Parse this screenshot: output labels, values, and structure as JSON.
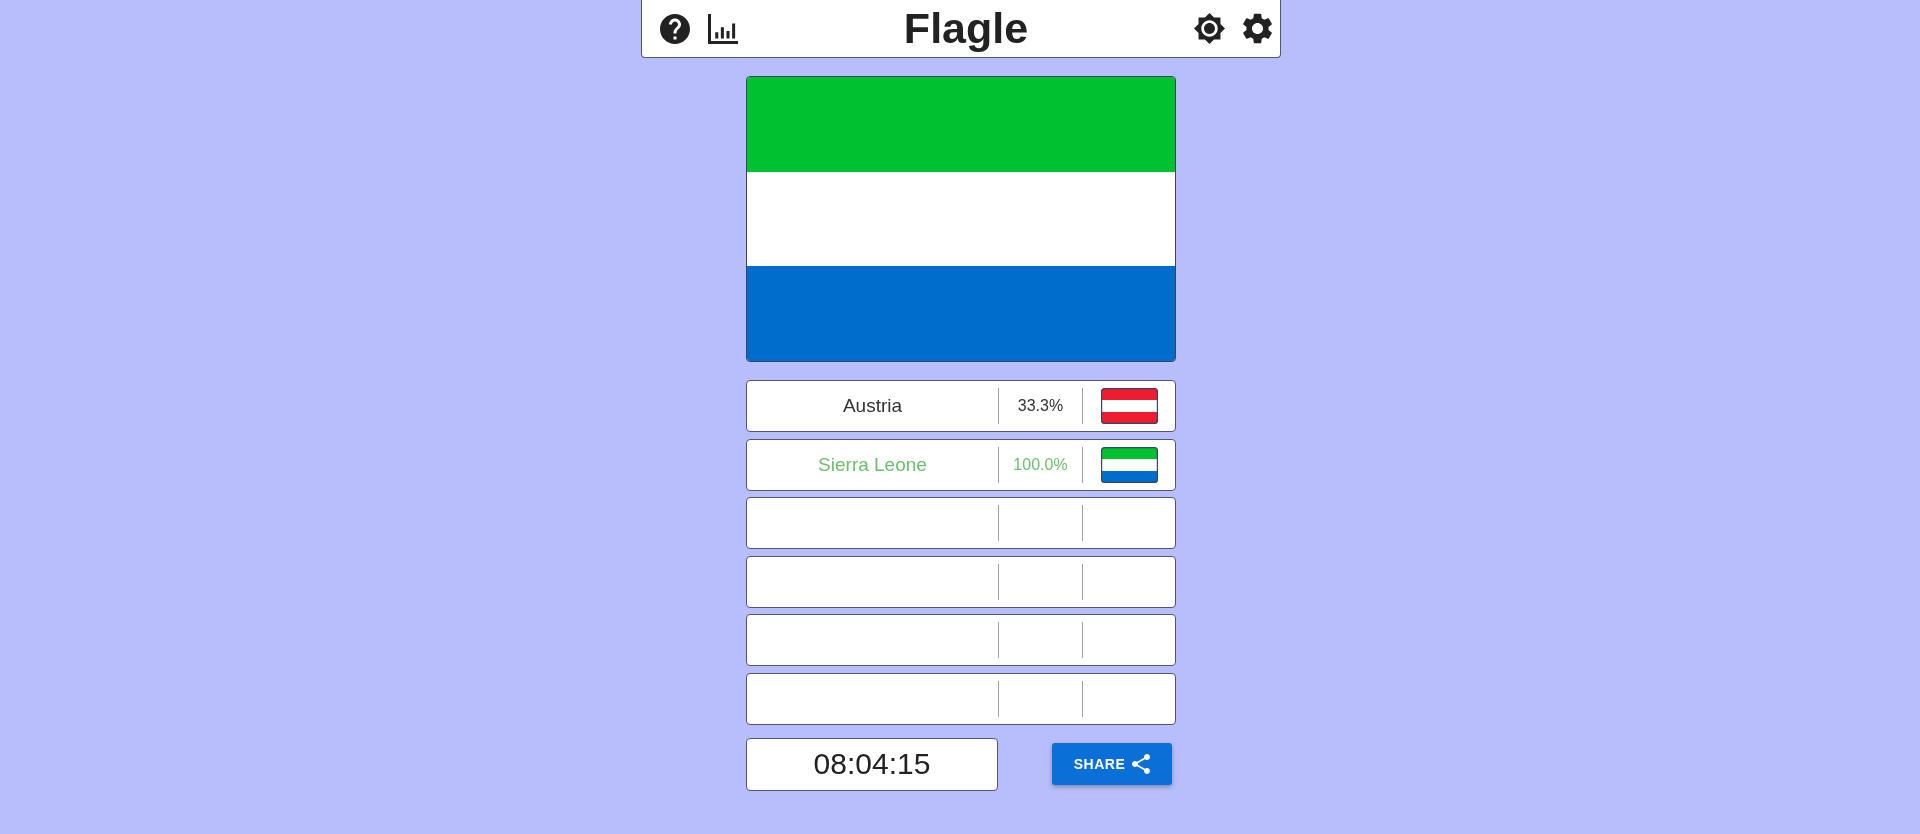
{
  "header": {
    "title": "Flagle"
  },
  "flag": {
    "stripes": [
      {
        "color": "#00c12f"
      },
      {
        "color": "#ffffff"
      },
      {
        "color": "#006dcc"
      }
    ]
  },
  "guesses": [
    {
      "kind": "guess",
      "country": "Austria",
      "percent": "33.3%",
      "correct": false,
      "stripes": [
        {
          "color": "#ee1c2e"
        },
        {
          "color": "#ffffff"
        },
        {
          "color": "#ee1c2e"
        }
      ]
    },
    {
      "kind": "guess",
      "country": "Sierra Leone",
      "percent": "100.0%",
      "correct": true,
      "stripes": [
        {
          "color": "#00c12f"
        },
        {
          "color": "#ffffff"
        },
        {
          "color": "#006dcc"
        }
      ]
    },
    {
      "kind": "empty"
    },
    {
      "kind": "empty"
    },
    {
      "kind": "empty"
    },
    {
      "kind": "empty"
    }
  ],
  "footer": {
    "timer": "08:04:15",
    "share_button": "SHARE"
  }
}
